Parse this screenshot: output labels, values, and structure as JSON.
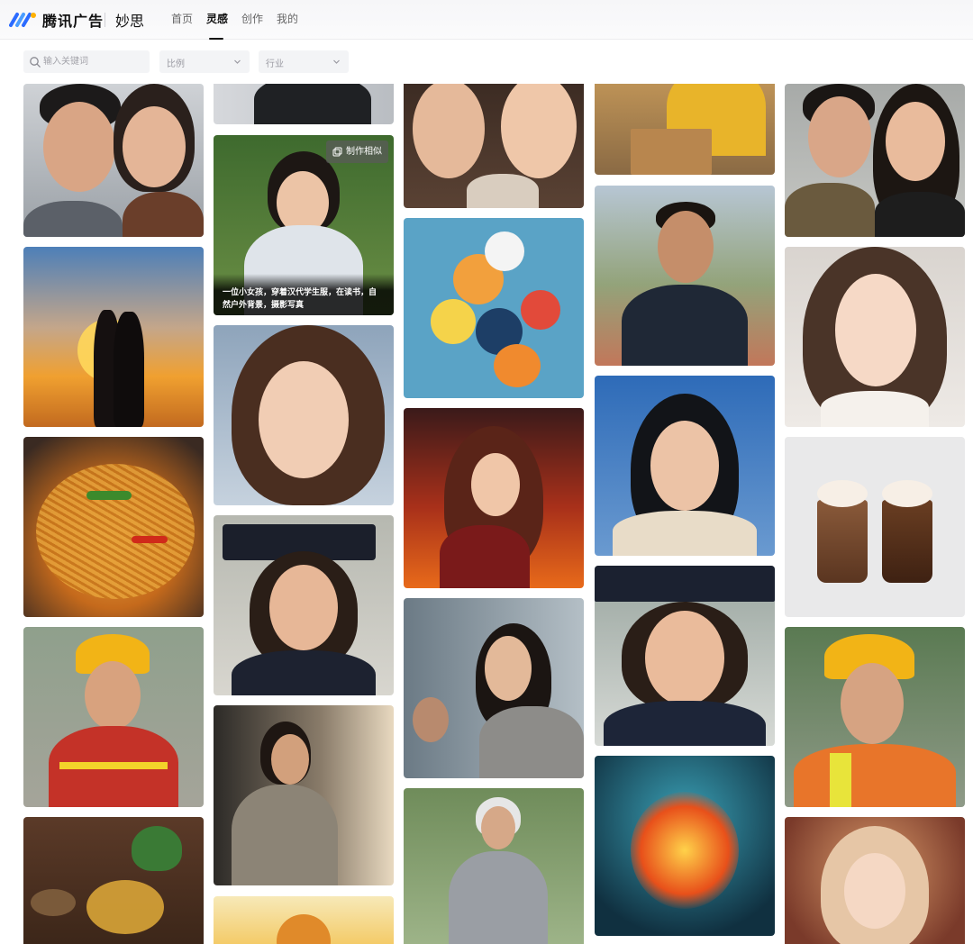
{
  "header": {
    "brand": "腾讯广告",
    "product": "妙思",
    "nav": [
      {
        "label": "首页",
        "active": false
      },
      {
        "label": "灵感",
        "active": true
      },
      {
        "label": "创作",
        "active": false
      },
      {
        "label": "我的",
        "active": false
      }
    ]
  },
  "filters": {
    "search_placeholder": "输入关键词",
    "ratio_label": "比例",
    "industry_label": "行业"
  },
  "hover_card": {
    "make_similar_label": "制作相似",
    "caption": "一位小女孩，穿着汉代学生服，在读书，自然户外背景，摄影写真"
  },
  "icons": [
    "search-icon",
    "chevron-down-icon",
    "copy-icon",
    "logo-icon"
  ],
  "colors": {
    "accent": "#2b6bff",
    "active_nav": "#111111"
  }
}
